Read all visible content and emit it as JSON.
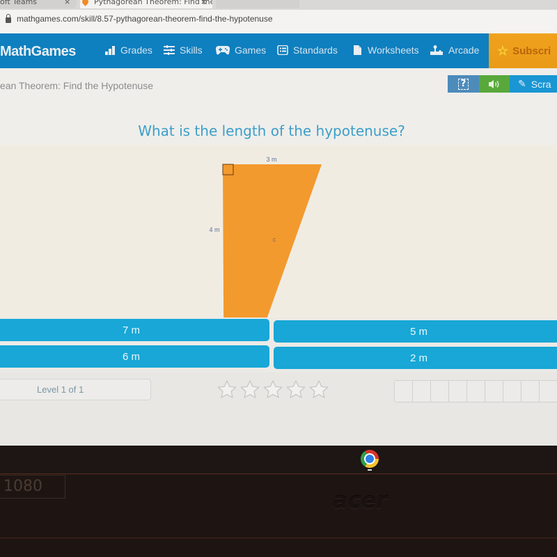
{
  "browser": {
    "tabs": [
      {
        "label": "oft Teams",
        "active": false
      },
      {
        "label": "Pythagorean Theorem: Find the",
        "active": true
      },
      {
        "label": "",
        "active": false
      }
    ],
    "tab_close_glyph": "×",
    "url": "mathgames.com/skill/8.57-pythagorean-theorem-find-the-hypotenuse"
  },
  "nav": {
    "logo": "MathGames",
    "items": [
      {
        "label": "Grades",
        "icon": "bar-chart-icon"
      },
      {
        "label": "Skills",
        "icon": "sliders-icon"
      },
      {
        "label": "Games",
        "icon": "gamepad-icon"
      },
      {
        "label": "Standards",
        "icon": "list-icon"
      },
      {
        "label": "Worksheets",
        "icon": "document-icon"
      },
      {
        "label": "Arcade",
        "icon": "joystick-icon"
      }
    ],
    "subscribe": {
      "label": "Subscri",
      "icon": "star-icon"
    }
  },
  "skill": {
    "title": "ean Theorem: Find the Hypotenuse",
    "tools": {
      "help_icon": "?",
      "sound_icon": "◀))",
      "scratch_label": "Scra",
      "scratch_icon": "✎"
    }
  },
  "question": {
    "text": "What is the length of the hypotenuse?",
    "figure": {
      "shape": "right-triangle",
      "fill": "#f39a2e",
      "labels": {
        "top": "3 m",
        "left": "4 m",
        "hypotenuse": "c"
      }
    }
  },
  "answers": [
    "7 m",
    "5 m",
    "6 m",
    "2 m"
  ],
  "progress": {
    "level": "Level 1 of 1",
    "stars_total": 5,
    "stars_earned": 0,
    "score_boxes_visible": 9
  },
  "colors": {
    "nav_bg": "#0e7fbf",
    "subscribe_bg": "#f0a21e",
    "answer_bg": "#18a7d6",
    "question_text": "#3d9fc8",
    "triangle": "#f39a2e",
    "help_bg": "#4d8bbb",
    "sound_bg": "#59a83c",
    "scratch_bg": "#1996d3"
  },
  "device": {
    "resolution_badge": "1080",
    "brand": "acer"
  }
}
